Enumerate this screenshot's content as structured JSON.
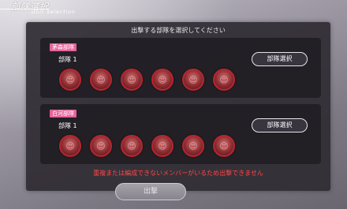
{
  "header": {
    "title": "部隊選択",
    "subtitle": "Unit Selection"
  },
  "panel": {
    "prompt": "出撃する部隊を選択してください",
    "warning": "重複または編成できないメンバーがいるため出撃できません"
  },
  "squads": [
    {
      "tag": "茅森部隊",
      "unit_label": "部隊 1",
      "select_label": "部隊選択",
      "members": [
        "portrait",
        "portrait",
        "portrait",
        "portrait",
        "portrait",
        "portrait"
      ]
    },
    {
      "tag": "白河部隊",
      "unit_label": "部隊 1",
      "select_label": "部隊選択",
      "members": [
        "portrait",
        "portrait",
        "portrait",
        "portrait",
        "portrait",
        "portrait"
      ]
    }
  ],
  "sortie": {
    "label": "出撃",
    "enabled": false
  },
  "colors": {
    "tag": "#e4649a",
    "member_border": "#b8262f",
    "warning": "#ff4646"
  }
}
